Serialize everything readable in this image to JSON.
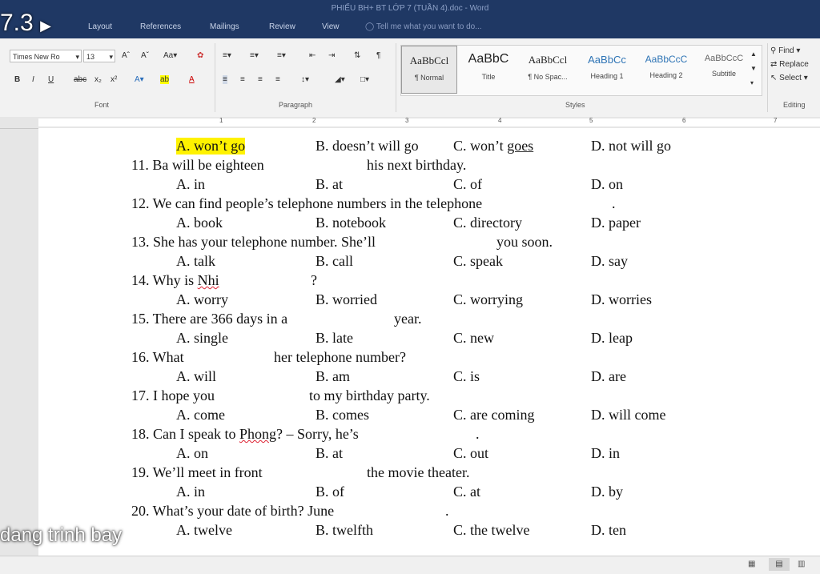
{
  "window": {
    "title": "PHIẾU BH+ BT LỚP 7 (TUẦN 4).doc - Word"
  },
  "menu": {
    "tabs": [
      "Layout",
      "References",
      "Mailings",
      "Review",
      "View"
    ],
    "tell_me": "Tell me what you want to do..."
  },
  "ribbon": {
    "font_name": "Times New Ro",
    "font_size": "13",
    "font_group": "Font",
    "paragraph_group": "Paragraph",
    "styles_group": "Styles",
    "editing_group": "Editing",
    "styles": [
      {
        "sample": "AaBbCcl",
        "name": "¶ Normal"
      },
      {
        "sample": "AaBbC",
        "name": "Title"
      },
      {
        "sample": "AaBbCcl",
        "name": "¶ No Spac..."
      },
      {
        "sample": "AaBbCc",
        "name": "Heading 1"
      },
      {
        "sample": "AaBbCcC",
        "name": "Heading 2"
      },
      {
        "sample": "AaBbCcC",
        "name": "Subtitle"
      }
    ],
    "editing": {
      "find": "Find",
      "replace": "Replace",
      "select": "Select"
    }
  },
  "ruler": {
    "numbers": [
      "1",
      "2",
      "3",
      "4",
      "5",
      "6",
      "7"
    ]
  },
  "overlay": {
    "top": "7.3",
    "bottom": "dang trinh bay"
  },
  "document": {
    "q10_options": {
      "a": "A. won’t go",
      "b": "B. doesn’t will go",
      "c_prefix": "C. won’t ",
      "c_word": "goes",
      "d": "D. not will go"
    },
    "q11": {
      "q1": "11. Ba will be eighteen",
      "q2": "his next birthday.",
      "a": "A. in",
      "b": "B. at",
      "c": "C. of",
      "d": "D. on"
    },
    "q12": {
      "q1": "12. We can find people’s telephone numbers in the telephone",
      "q2": ".",
      "a": "A. book",
      "b": "B. notebook",
      "c": "C. directory",
      "d": "D. paper"
    },
    "q13": {
      "q1": "13. She has your telephone number. She’ll",
      "q2": "you soon.",
      "a": "A. talk",
      "b": "B. call",
      "c": "C. speak",
      "d": "D. say"
    },
    "q14": {
      "q1_prefix": "14. Why is ",
      "q1_name": "Nhi",
      "q2": "?",
      "a": "A. worry",
      "b": "B. worried",
      "c": "C. worrying",
      "d": "D. worries"
    },
    "q15": {
      "q1": "15. There are 366 days in a",
      "q2": "year.",
      "a": "A. single",
      "b": "B. late",
      "c": "C. new",
      "d": "D. leap"
    },
    "q16": {
      "q1": "16. What",
      "q2": "her telephone number?",
      "a": "A. will",
      "b": "B. am",
      "c": "C. is",
      "d": "D. are"
    },
    "q17": {
      "q1": "17. I hope you",
      "q2": "to my birthday party.",
      "a": "A. come",
      "b": "B. comes",
      "c": "C. are coming",
      "d": "D. will come"
    },
    "q18": {
      "q1_prefix": "18. Can I speak to ",
      "q1_name": "Phong",
      "q1_suffix": "? – Sorry, he’s",
      "q2": ".",
      "a": "A. on",
      "b": "B. at",
      "c": "C. out",
      "d": "D. in"
    },
    "q19": {
      "q1": "19. We’ll meet in front",
      "q2": "the movie theater.",
      "a": "A. in",
      "b": "B. of",
      "c": "C. at",
      "d": "D. by"
    },
    "q20": {
      "q1": "20. What’s your date of birth? June",
      "q2": ".",
      "a": "A. twelve",
      "b": "B. twelfth",
      "c": "C. the twelve",
      "d": "D. ten"
    }
  }
}
